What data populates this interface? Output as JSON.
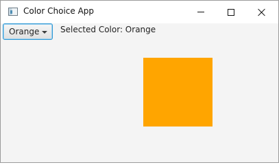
{
  "window": {
    "title": "Color Choice App",
    "controls": {
      "minimize": "minimize",
      "maximize": "maximize",
      "close": "close"
    }
  },
  "toolbar": {
    "color_select_value": "Orange"
  },
  "status": {
    "selected_color_text": "Selected Color: Orange"
  },
  "colors": {
    "orange_swatch": "#ffa500"
  }
}
